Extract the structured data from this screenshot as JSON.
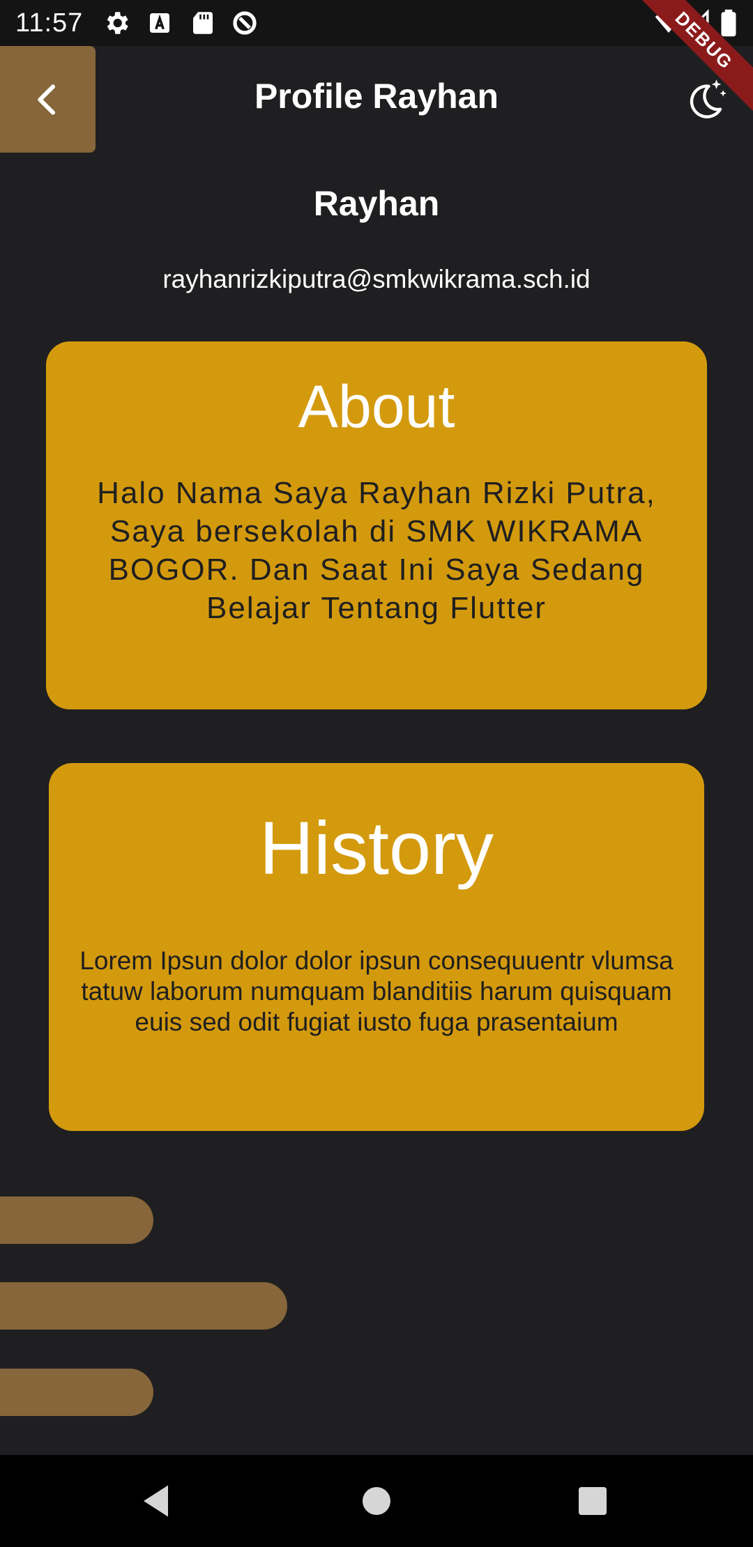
{
  "status_bar": {
    "time": "11:57",
    "icons": [
      "settings-icon",
      "font-a-icon",
      "sd-card-icon",
      "data-saver-icon",
      "wifi-icon",
      "signal-icon",
      "battery-icon"
    ]
  },
  "debug_banner": {
    "label": "DEBUG"
  },
  "app_bar": {
    "title": "Profile Rayhan",
    "back_icon": "chevron-left-icon",
    "theme_icon": "moon-stars-icon"
  },
  "profile": {
    "name": "Rayhan",
    "email": "rayhanrizkiputra@smkwikrama.sch.id"
  },
  "about": {
    "title": "About",
    "body": "Halo Nama Saya Rayhan Rizki Putra, Saya bersekolah di SMK WIKRAMA BOGOR. Dan Saat Ini Saya Sedang Belajar Tentang Flutter"
  },
  "history": {
    "title": "History",
    "body": "Lorem Ipsun dolor dolor ipsun consequuentr vlumsa tatuw laborum numquam blanditiis harum quisquam euis sed odit fugiat iusto fuga prasentaium"
  },
  "nav_bar": {
    "icons": [
      "back-triangle-icon",
      "home-circle-icon",
      "recents-square-icon"
    ]
  },
  "colors": {
    "background": "#1f1f21",
    "card": "#d49a0e",
    "accent_brown": "#86663a",
    "debug_red": "#8b1b1b"
  }
}
